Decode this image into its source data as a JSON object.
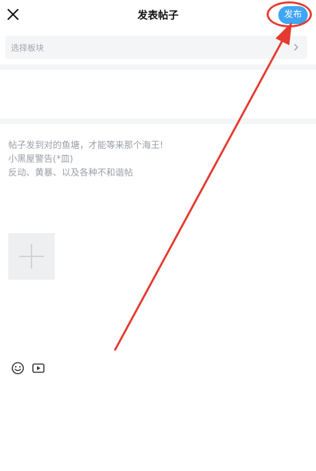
{
  "header": {
    "title": "发表帖子",
    "publish_label": "发布",
    "close_icon": "close-icon"
  },
  "board_selector": {
    "placeholder": "选择板块",
    "chevron_icon": "chevron-right-icon"
  },
  "content": {
    "placeholder_lines": [
      "帖子发到对的鱼塘，才能等来那个海王!",
      "小黑屋警告(*皿)",
      "反动、黄暴、以及各种不和谐帖"
    ]
  },
  "media": {
    "add_image_icon": "plus-icon"
  },
  "toolbar": {
    "emoji_icon": "emoji-icon",
    "video_icon": "video-icon"
  },
  "colors": {
    "accent": "#3fa5f5",
    "annotation": "#e53a2f",
    "placeholder_text": "#9a9ea6",
    "background_gray": "#f4f5f7"
  }
}
